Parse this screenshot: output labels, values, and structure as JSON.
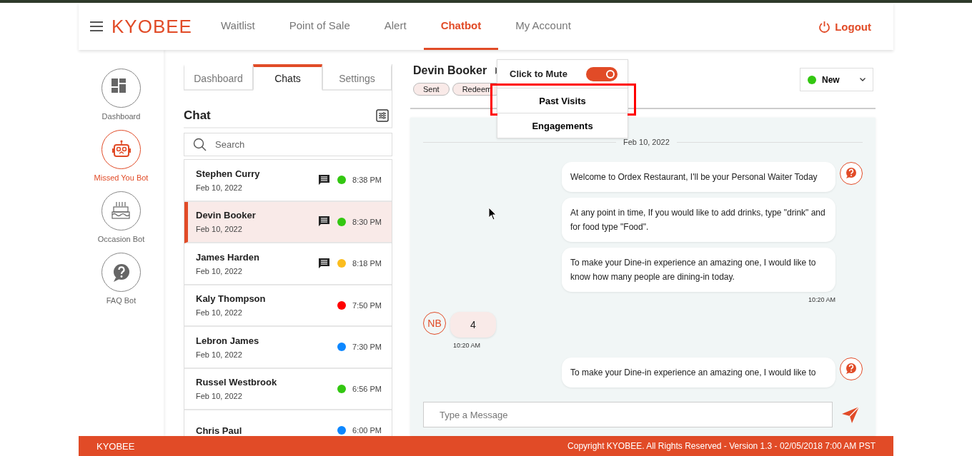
{
  "header": {
    "brand": "KYOBEE",
    "tabs": [
      {
        "label": "Waitlist",
        "selected": false
      },
      {
        "label": "Point of Sale",
        "selected": false
      },
      {
        "label": "Alert",
        "selected": false
      },
      {
        "label": "Chatbot",
        "selected": true
      },
      {
        "label": "My Account",
        "selected": false
      }
    ],
    "logout": "Logout"
  },
  "sidebar": {
    "items": [
      {
        "label": "Dashboard",
        "selected": false
      },
      {
        "label": "Missed You Bot",
        "selected": true
      },
      {
        "label": "Occasion Bot",
        "selected": false
      },
      {
        "label": "FAQ Bot",
        "selected": false
      }
    ]
  },
  "chat_list": {
    "tabs": [
      {
        "label": "Dashboard",
        "selected": false
      },
      {
        "label": "Chats",
        "selected": true
      },
      {
        "label": "Settings",
        "selected": false
      }
    ],
    "title": "Chat",
    "search": {
      "placeholder": "Search"
    },
    "chats": [
      {
        "name": "Stephen Curry",
        "date": "Feb 10, 2022",
        "time": "8:38 PM",
        "message_icon": true,
        "color": "#33c711",
        "selected": false
      },
      {
        "name": "Devin Booker",
        "date": "Feb 10, 2022",
        "time": "8:30 PM",
        "message_icon": true,
        "color": "#33c711",
        "selected": true
      },
      {
        "name": "James Harden",
        "date": "Feb 10, 2022",
        "time": "8:18 PM",
        "message_icon": true,
        "color": "#fbbd1e",
        "selected": false
      },
      {
        "name": "Kaly Thompson",
        "date": "Feb 10, 2022",
        "time": "7:50 PM",
        "message_icon": false,
        "color": "#ff0000",
        "selected": false
      },
      {
        "name": "Lebron James",
        "date": "Feb 10, 2022",
        "time": "7:30 PM",
        "message_icon": false,
        "color": "#0d87ff",
        "selected": false
      },
      {
        "name": "Russel Westbrook",
        "date": "Feb 10, 2022",
        "time": "6:56 PM",
        "message_icon": false,
        "color": "#33c711",
        "selected": false
      },
      {
        "name": "Chris Paul",
        "time": "6:00 PM",
        "message_icon": false,
        "color": "#0d87ff",
        "selected": false
      }
    ]
  },
  "conversation": {
    "name": "Devin Booker",
    "tags": [
      "Sent",
      "Redeem"
    ],
    "status": "New",
    "menu": {
      "mute": {
        "label": "Click to Mute",
        "on": true
      },
      "items": [
        {
          "label": "Past Visits",
          "highlighted": true
        },
        {
          "label": "Engagements",
          "highlighted": false
        }
      ]
    },
    "date": "Feb 10, 2022",
    "groups": [
      {
        "kind": "bot",
        "bubbles": [
          "Welcome to Ordex Restaurant, I'll be your Personal Waiter Today",
          "At any point in time, If you would like to add drinks, type \"drink\" and for food type \"Food\".",
          "To make your Dine-in experience an amazing one, I would like to know how many people are dining-in today."
        ],
        "time": "10:20 AM"
      },
      {
        "kind": "user",
        "avatar": "NB",
        "bubbles": [
          "4"
        ],
        "time": "10:20 AM"
      },
      {
        "kind": "bot",
        "bubbles": [
          "To make your Dine-in experience an amazing one, I would like to"
        ]
      }
    ],
    "input": {
      "placeholder": "Type a Message"
    }
  },
  "footer": {
    "brand": "KYOBEE",
    "copyright": "Copyright KYOBEE. All Rights Reserved - Version 1.3 - 02/05/2018 7:00 AM PST"
  }
}
